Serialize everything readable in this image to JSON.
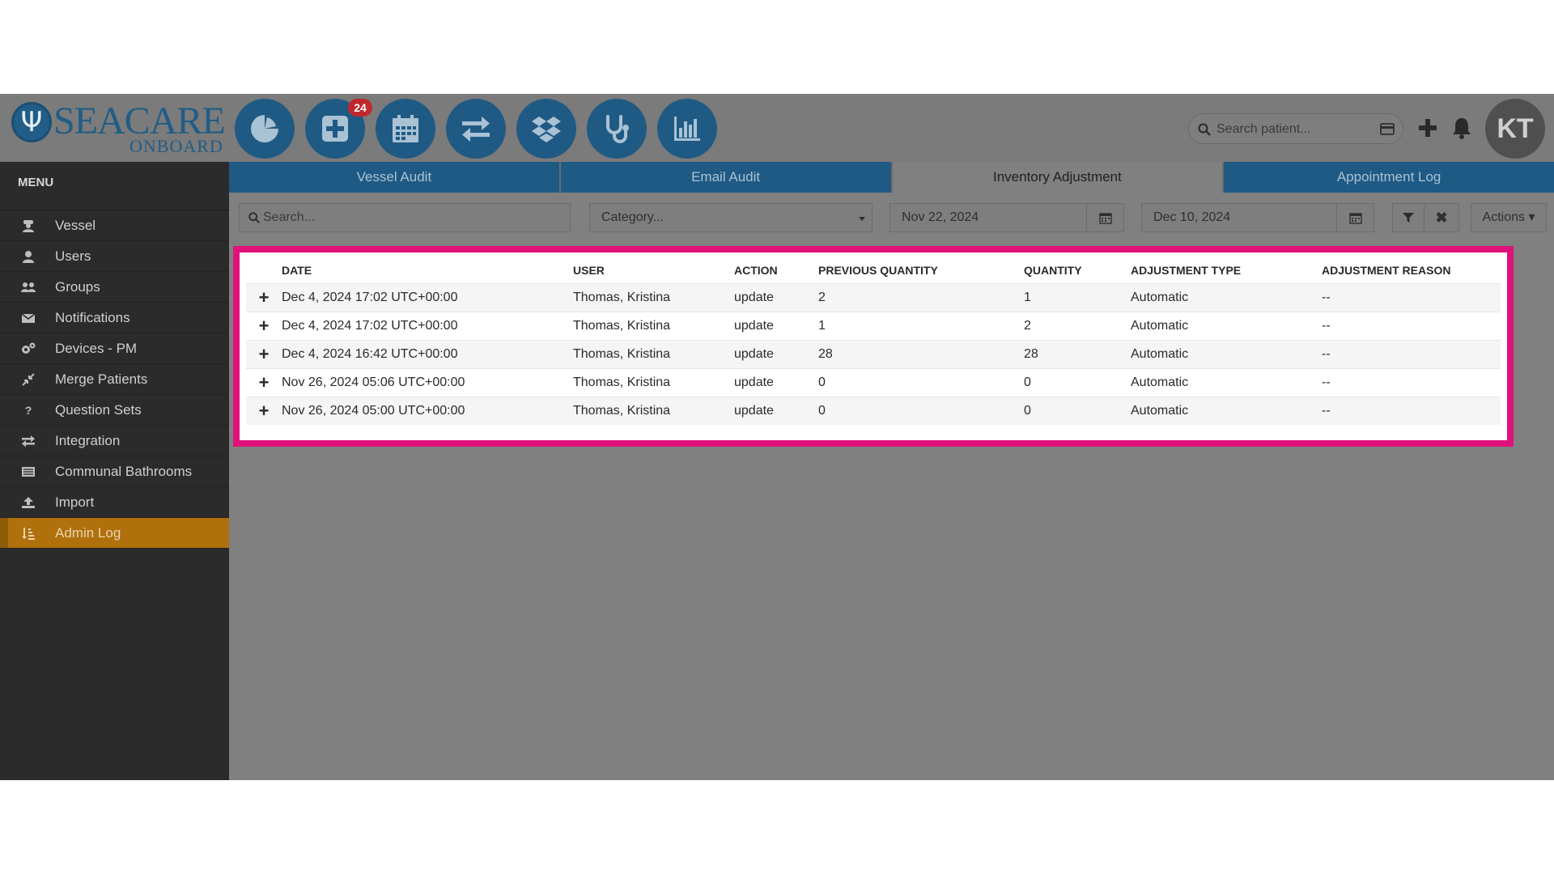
{
  "brand": {
    "name": "SEACARE",
    "sub": "ONBOARD"
  },
  "header": {
    "badge_count": "24",
    "search_placeholder": "Search patient...",
    "avatar_initials": "KT"
  },
  "sidebar": {
    "title": "MENU",
    "items": [
      {
        "label": "Vessel",
        "icon": "captain-icon"
      },
      {
        "label": "Users",
        "icon": "user-icon"
      },
      {
        "label": "Groups",
        "icon": "users-icon"
      },
      {
        "label": "Notifications",
        "icon": "envelope-icon"
      },
      {
        "label": "Devices - PM",
        "icon": "gears-icon"
      },
      {
        "label": "Merge Patients",
        "icon": "compress-icon"
      },
      {
        "label": "Question Sets",
        "icon": "question-icon"
      },
      {
        "label": "Integration",
        "icon": "exchange-icon"
      },
      {
        "label": "Communal Bathrooms",
        "icon": "list-icon"
      },
      {
        "label": "Import",
        "icon": "upload-icon"
      },
      {
        "label": "Admin Log",
        "icon": "sort-icon"
      }
    ],
    "active_item": "Admin Log"
  },
  "tabs": [
    {
      "label": "Vessel Audit"
    },
    {
      "label": "Email Audit"
    },
    {
      "label": "Inventory Adjustment"
    },
    {
      "label": "Appointment Log"
    }
  ],
  "active_tab": "Inventory Adjustment",
  "filters": {
    "search_placeholder": "Search...",
    "category_placeholder": "Category...",
    "date_from": "Nov 22, 2024",
    "date_to": "Dec 10, 2024",
    "actions_label": "Actions"
  },
  "table": {
    "columns": [
      "DATE",
      "USER",
      "ACTION",
      "PREVIOUS QUANTITY",
      "QUANTITY",
      "ADJUSTMENT TYPE",
      "ADJUSTMENT REASON"
    ],
    "rows": [
      [
        "Dec 4, 2024 17:02 UTC+00:00",
        "Thomas, Kristina",
        "update",
        "2",
        "1",
        "Automatic",
        "--"
      ],
      [
        "Dec 4, 2024 17:02 UTC+00:00",
        "Thomas, Kristina",
        "update",
        "1",
        "2",
        "Automatic",
        "--"
      ],
      [
        "Dec 4, 2024 16:42 UTC+00:00",
        "Thomas, Kristina",
        "update",
        "28",
        "28",
        "Automatic",
        "--"
      ],
      [
        "Nov 26, 2024 05:06 UTC+00:00",
        "Thomas, Kristina",
        "update",
        "0",
        "0",
        "Automatic",
        "--"
      ],
      [
        "Nov 26, 2024 05:00 UTC+00:00",
        "Thomas, Kristina",
        "update",
        "0",
        "0",
        "Automatic",
        "--"
      ]
    ]
  },
  "colors": {
    "primary": "#1f5a84",
    "active_menu": "#b0700c",
    "highlight": "#e0117a",
    "badge": "#c0282c"
  }
}
